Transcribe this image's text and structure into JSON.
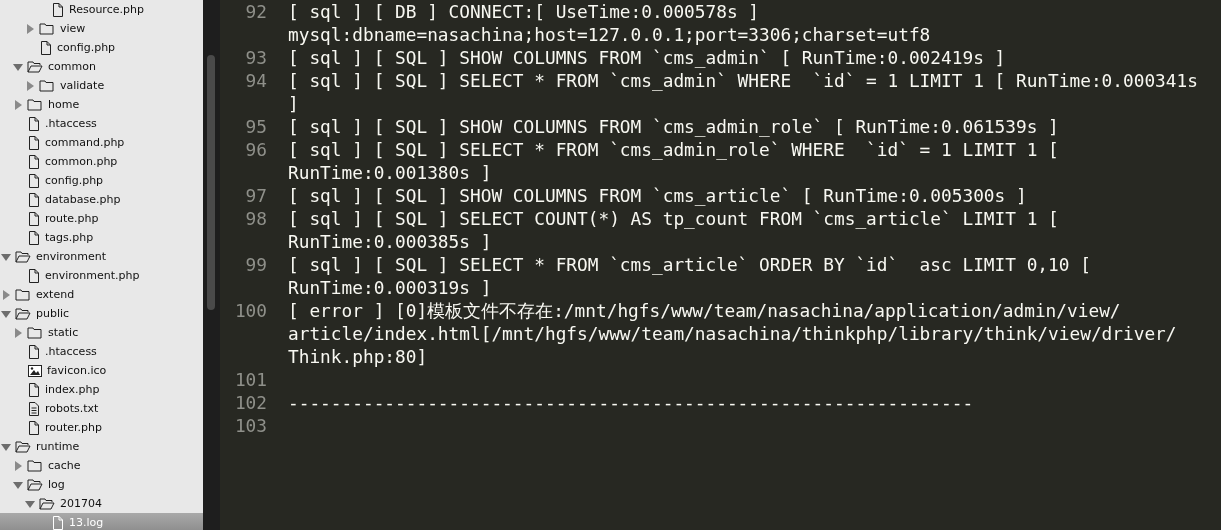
{
  "sidebar": {
    "tree": [
      {
        "children": [
          {
            "children": [
              {
                "children": [
                  {
                    "kind": "file",
                    "label": "Resource.php",
                    "selected": false
                  }
                ]
              },
              {
                "kind": "folder",
                "label": "view",
                "expanded": false
              },
              {
                "kind": "file",
                "label": "config.php",
                "selected": false
              }
            ]
          },
          {
            "kind": "folder",
            "label": "common",
            "expanded": true,
            "children": [
              {
                "kind": "folder",
                "label": "validate",
                "expanded": false
              }
            ]
          },
          {
            "kind": "folder",
            "label": "home",
            "expanded": false
          },
          {
            "kind": "file",
            "label": ".htaccess",
            "selected": false
          },
          {
            "kind": "file",
            "label": "command.php",
            "selected": false
          },
          {
            "kind": "file",
            "label": "common.php",
            "selected": false
          },
          {
            "kind": "file",
            "label": "config.php",
            "selected": false
          },
          {
            "kind": "file",
            "label": "database.php",
            "selected": false
          },
          {
            "kind": "file",
            "label": "route.php",
            "selected": false
          },
          {
            "kind": "file",
            "label": "tags.php",
            "selected": false
          }
        ]
      },
      {
        "kind": "folder",
        "label": "environment",
        "expanded": true,
        "children": [
          {
            "kind": "file",
            "label": "environment.php",
            "selected": false
          }
        ]
      },
      {
        "kind": "folder",
        "label": "extend",
        "expanded": false
      },
      {
        "kind": "folder",
        "label": "public",
        "expanded": true,
        "children": [
          {
            "kind": "folder",
            "label": "static",
            "expanded": false
          },
          {
            "kind": "file",
            "label": ".htaccess",
            "selected": false
          },
          {
            "kind": "image",
            "label": "favicon.ico",
            "selected": false
          },
          {
            "kind": "file",
            "label": "index.php",
            "selected": false
          },
          {
            "kind": "text",
            "label": "robots.txt",
            "selected": false
          },
          {
            "kind": "file",
            "label": "router.php",
            "selected": false
          }
        ]
      },
      {
        "kind": "folder",
        "label": "runtime",
        "expanded": true,
        "children": [
          {
            "kind": "folder",
            "label": "cache",
            "expanded": false
          },
          {
            "kind": "folder",
            "label": "log",
            "expanded": true,
            "children": [
              {
                "kind": "folder",
                "label": "201704",
                "expanded": true,
                "children": [
                  {
                    "kind": "file",
                    "label": "13.log",
                    "selected": true
                  }
                ]
              }
            ]
          }
        ]
      }
    ]
  },
  "editor": {
    "lines": [
      {
        "number": "92",
        "text": [
          "[ sql ] [ DB ] CONNECT:[ UseTime:0.000578s ]",
          "mysql:dbname=nasachina;host=127.0.0.1;port=3306;charset=utf8"
        ]
      },
      {
        "number": "93",
        "text": [
          "[ sql ] [ SQL ] SHOW COLUMNS FROM `cms_admin` [ RunTime:0.002419s ]"
        ]
      },
      {
        "number": "94",
        "text": [
          "[ sql ] [ SQL ] SELECT * FROM `cms_admin` WHERE  `id` = 1 LIMIT 1 [ RunTime:0.000341s",
          "]"
        ]
      },
      {
        "number": "95",
        "text": [
          "[ sql ] [ SQL ] SHOW COLUMNS FROM `cms_admin_role` [ RunTime:0.061539s ]"
        ]
      },
      {
        "number": "96",
        "text": [
          "[ sql ] [ SQL ] SELECT * FROM `cms_admin_role` WHERE  `id` = 1 LIMIT 1 [",
          "RunTime:0.001380s ]"
        ]
      },
      {
        "number": "97",
        "text": [
          "[ sql ] [ SQL ] SHOW COLUMNS FROM `cms_article` [ RunTime:0.005300s ]"
        ]
      },
      {
        "number": "98",
        "text": [
          "[ sql ] [ SQL ] SELECT COUNT(*) AS tp_count FROM `cms_article` LIMIT 1 [",
          "RunTime:0.000385s ]"
        ]
      },
      {
        "number": "99",
        "text": [
          "[ sql ] [ SQL ] SELECT * FROM `cms_article` ORDER BY `id`  asc LIMIT 0,10 [",
          "RunTime:0.000319s ]"
        ]
      },
      {
        "number": "100",
        "text": [
          "[ error ] [0]模板文件不存在:/mnt/hgfs/www/team/nasachina/application/admin/view/",
          "article/index.html[/mnt/hgfs/www/team/nasachina/thinkphp/library/think/view/driver/",
          "Think.php:80]"
        ]
      },
      {
        "number": "101"
      },
      {
        "number": "102",
        "text": [
          "----------------------------------------------------------------"
        ]
      },
      {
        "number": "103"
      }
    ]
  }
}
